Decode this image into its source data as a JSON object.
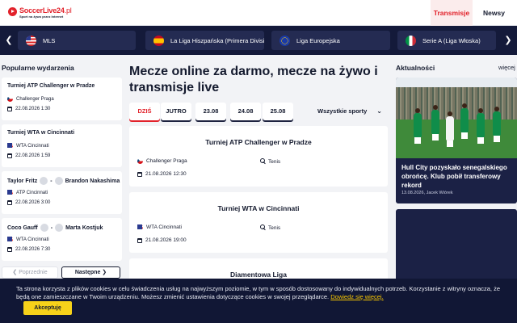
{
  "brand": {
    "name_main": "SoccerLive24",
    "name_suffix": ".pl",
    "tagline": "Sport na żywo przez Internet",
    "accent": "#e2222b",
    "navy": "#141a3a"
  },
  "nav": {
    "transmisje": "Transmisje",
    "newsy": "Newsy"
  },
  "leagues": [
    {
      "label": "MLS",
      "flag": "us-flag-icon"
    },
    {
      "label": "La Liga Hiszpańska (Primera Division)",
      "flag": "spain-flag-icon"
    },
    {
      "label": "Liga Europejska",
      "flag": "eu-flag-icon"
    },
    {
      "label": "Serie A (Liga Włoska)",
      "flag": "italy-flag-icon"
    }
  ],
  "sidebar": {
    "title": "Popularne wydarzenia",
    "events": [
      {
        "title": "Turniej ATP Challenger w Pradze",
        "tournament": "Challenger Praga",
        "date": "22.08.2026 1:30"
      },
      {
        "title": "Turniej WTA w Cincinnati",
        "tournament": "WTA Cincinnati",
        "date": "22.08.2026 1:59"
      },
      {
        "player1": "Taylor Fritz",
        "separator": "-",
        "player2": "Brandon Nakashima",
        "tournament": "ATP Cincinnati",
        "date": "22.08.2026 3:00"
      },
      {
        "player1": "Coco Gauff",
        "separator": "-",
        "player2": "Marta Kostjuk",
        "tournament": "WTA Cincinnati",
        "date": "22.08.2026 7:30"
      }
    ],
    "prev": "Poprzednie",
    "next": "Następne"
  },
  "main": {
    "heading": "Mecze online za darmo, mecze na żywo i transmisje live",
    "days": [
      "DZIŚ",
      "JUTRO",
      "23.08",
      "24.08",
      "25.08"
    ],
    "filter": "Wszystkie sporty",
    "matches": [
      {
        "title": "Turniej ATP Challenger w Pradze",
        "tournament": "Challenger Praga",
        "sport": "Tenis",
        "datetime": "21.08.2026 12:30"
      },
      {
        "title": "Turniej WTA w Cincinnati",
        "tournament": "WTA Cincinnati",
        "sport": "Tenis",
        "datetime": "21.08.2026 19:00"
      },
      {
        "title": "Diamentowa Liga"
      }
    ]
  },
  "news": {
    "title": "Aktualności",
    "more": "więcej",
    "featured": {
      "headline": "Hull City pozyskało senegalskiego obrońcę. Klub pobił transferowy rekord",
      "meta": "13.08.2026, Jacek Wiórek"
    }
  },
  "cookie": {
    "text": "Ta strona korzysta z plików cookies w celu świadczenia usług na najwyższym poziomie, w tym w sposób dostosowany do indywidualnych potrzeb. Korzystanie z witryny oznacza, że będą one zamieszczane w Twoim urządzeniu. Możesz zmienić ustawienia dotyczące cookies w swojej przeglądarce.",
    "link": "Dowiedz się więcej.",
    "accept": "Akceptuję"
  }
}
